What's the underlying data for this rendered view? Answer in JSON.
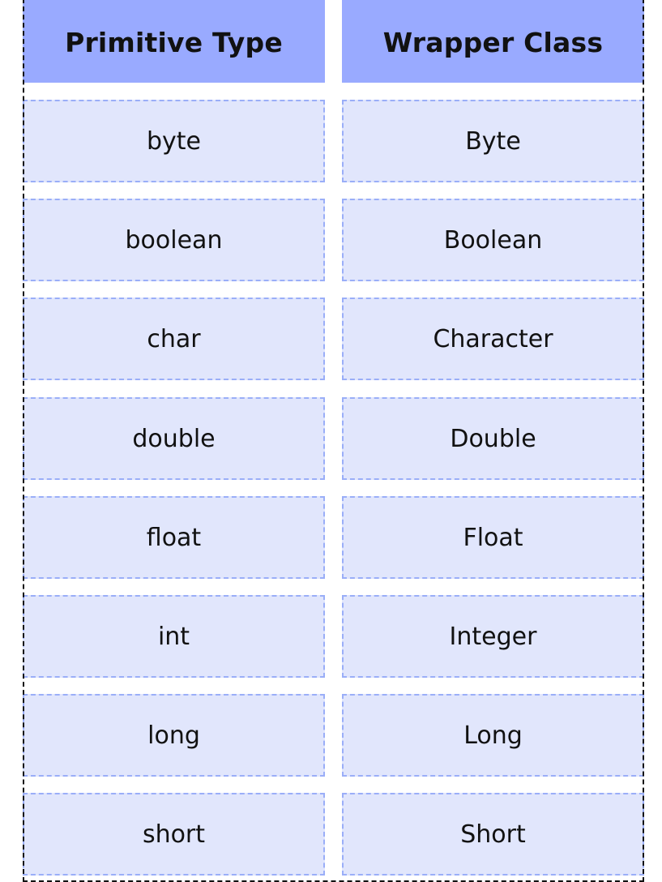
{
  "table": {
    "headers": [
      "Primitive Type",
      "Wrapper Class"
    ],
    "rows": [
      [
        "byte",
        "Byte"
      ],
      [
        "boolean",
        "Boolean"
      ],
      [
        "char",
        "Character"
      ],
      [
        "double",
        "Double"
      ],
      [
        "float",
        "Float"
      ],
      [
        "int",
        "Integer"
      ],
      [
        "long",
        "Long"
      ],
      [
        "short",
        "Short"
      ]
    ]
  },
  "colors": {
    "header_background": "#99aaff",
    "cell_background": "#e1e6fc",
    "cell_border": "#9aaef8",
    "outer_border": "#111111",
    "text": "#111111"
  }
}
